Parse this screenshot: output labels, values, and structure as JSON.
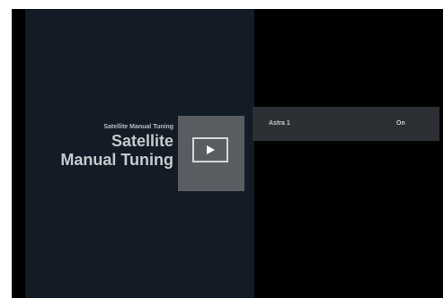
{
  "page": {
    "small_title": "Satellite Manual Tuning",
    "title_line1": "Satellite",
    "title_line2": "Manual Tuning"
  },
  "icon": {
    "name": "play-icon"
  },
  "list": {
    "items": [
      {
        "name": "Astra 1",
        "value": "On"
      }
    ]
  },
  "colors": {
    "screen_bg": "#000000",
    "left_panel_bg": "#131c26",
    "icon_tile_bg": "#595d62",
    "row_bg": "#2c3035",
    "text": "#c6c9cd"
  }
}
